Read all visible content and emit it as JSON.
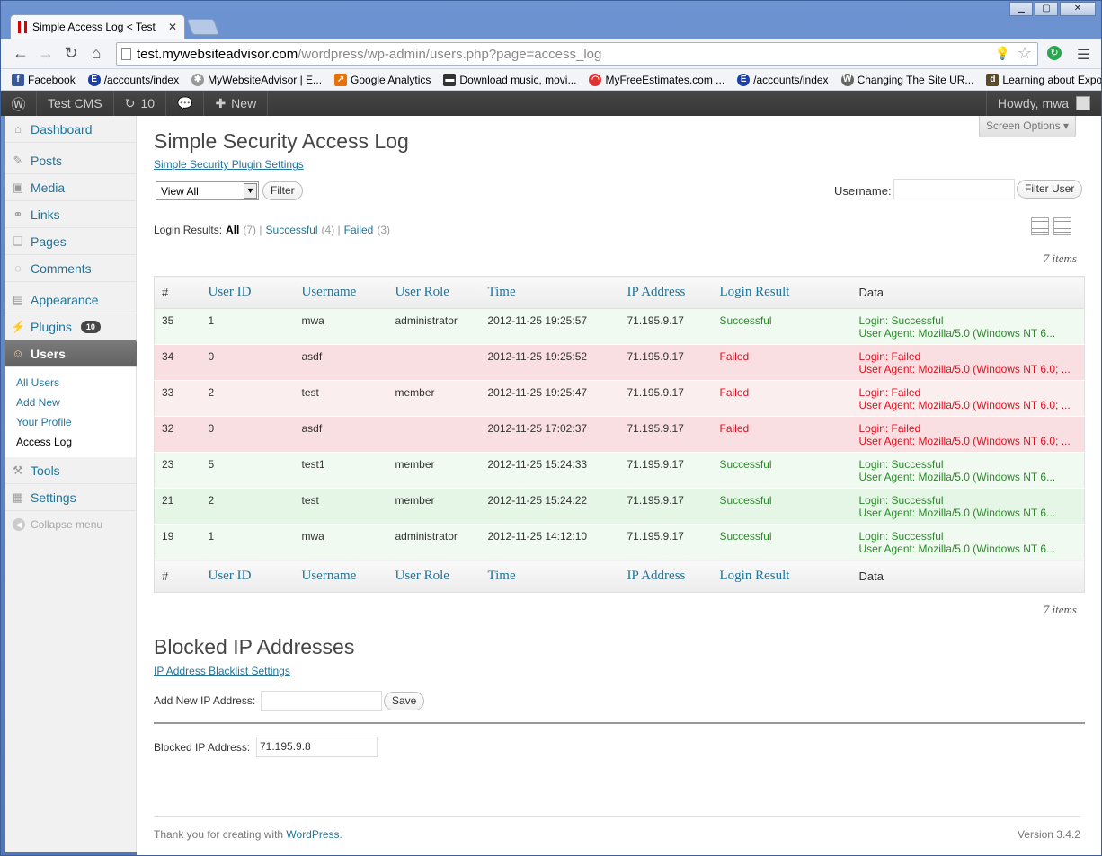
{
  "browser": {
    "tab_title": "Simple Access Log < Test CMS",
    "url_host": "test.mywebsiteadvisor.com",
    "url_path": "/wordpress/wp-admin/users.php?page=access_log",
    "bookmarks": [
      {
        "label": "Facebook"
      },
      {
        "label": "/accounts/index"
      },
      {
        "label": "MyWebsiteAdvisor | E..."
      },
      {
        "label": "Google Analytics"
      },
      {
        "label": "Download music, movi..."
      },
      {
        "label": "MyFreeEstimates.com ..."
      },
      {
        "label": "/accounts/index"
      },
      {
        "label": "Changing The Site UR..."
      },
      {
        "label": "Learning about Expos..."
      }
    ]
  },
  "adminbar": {
    "site": "Test CMS",
    "updates": "10",
    "new": "New",
    "howdy": "Howdy, mwa"
  },
  "sidebar": {
    "dashboard": "Dashboard",
    "posts": "Posts",
    "media": "Media",
    "links": "Links",
    "pages": "Pages",
    "comments": "Comments",
    "appearance": "Appearance",
    "plugins": "Plugins",
    "plugins_badge": "10",
    "users": "Users",
    "sub": [
      "All Users",
      "Add New",
      "Your Profile",
      "Access Log"
    ],
    "tools": "Tools",
    "settings": "Settings",
    "collapse": "Collapse menu"
  },
  "main": {
    "screen_options": "Screen Options",
    "title": "Simple Security Access Log",
    "settings_link": "Simple Security Plugin Settings",
    "view_select": "View All",
    "filter_btn": "Filter",
    "username_label": "Username:",
    "filter_user_btn": "Filter User",
    "results_label": "Login Results:",
    "all": "All",
    "all_count": "(7) |",
    "successful": "Successful",
    "successful_count": "(4) |",
    "failed": "Failed",
    "failed_count": "(3)",
    "items": "7 items",
    "columns": [
      "#",
      "User ID",
      "Username",
      "User Role",
      "Time",
      "IP Address",
      "Login Result",
      "Data"
    ],
    "rows": [
      {
        "id": "35",
        "uid": "1",
        "user": "mwa",
        "role": "administrator",
        "time": "2012-11-25 19:25:57",
        "ip": "71.195.9.17",
        "result": "Successful",
        "data1": "Login: Successful",
        "data2": "User Agent: Mozilla/5.0 (Windows NT 6..."
      },
      {
        "id": "34",
        "uid": "0",
        "user": "asdf",
        "role": "",
        "time": "2012-11-25 19:25:52",
        "ip": "71.195.9.17",
        "result": "Failed",
        "data1": "Login: Failed",
        "data2": "User Agent: Mozilla/5.0 (Windows NT 6.0; ..."
      },
      {
        "id": "33",
        "uid": "2",
        "user": "test",
        "role": "member",
        "time": "2012-11-25 19:25:47",
        "ip": "71.195.9.17",
        "result": "Failed",
        "data1": "Login: Failed",
        "data2": "User Agent: Mozilla/5.0 (Windows NT 6.0; ..."
      },
      {
        "id": "32",
        "uid": "0",
        "user": "asdf",
        "role": "",
        "time": "2012-11-25 17:02:37",
        "ip": "71.195.9.17",
        "result": "Failed",
        "data1": "Login: Failed",
        "data2": "User Agent: Mozilla/5.0 (Windows NT 6.0; ..."
      },
      {
        "id": "23",
        "uid": "5",
        "user": "test1",
        "role": "member",
        "time": "2012-11-25 15:24:33",
        "ip": "71.195.9.17",
        "result": "Successful",
        "data1": "Login: Successful",
        "data2": "User Agent: Mozilla/5.0 (Windows NT 6..."
      },
      {
        "id": "21",
        "uid": "2",
        "user": "test",
        "role": "member",
        "time": "2012-11-25 15:24:22",
        "ip": "71.195.9.17",
        "result": "Successful",
        "data1": "Login: Successful",
        "data2": "User Agent: Mozilla/5.0 (Windows NT 6..."
      },
      {
        "id": "19",
        "uid": "1",
        "user": "mwa",
        "role": "administrator",
        "time": "2012-11-25 14:12:10",
        "ip": "71.195.9.17",
        "result": "Successful",
        "data1": "Login: Successful",
        "data2": "User Agent: Mozilla/5.0 (Windows NT 6..."
      }
    ],
    "blocked_title": "Blocked IP Addresses",
    "blacklist_link": "IP Address Blacklist Settings",
    "add_ip_label": "Add New IP Address:",
    "save_btn": "Save",
    "blocked_label": "Blocked IP Address:",
    "blocked_value": "71.195.9.8",
    "footer_text": "Thank you for creating with ",
    "footer_link": "WordPress",
    "footer_dot": ".",
    "version": "Version 3.4.2"
  }
}
